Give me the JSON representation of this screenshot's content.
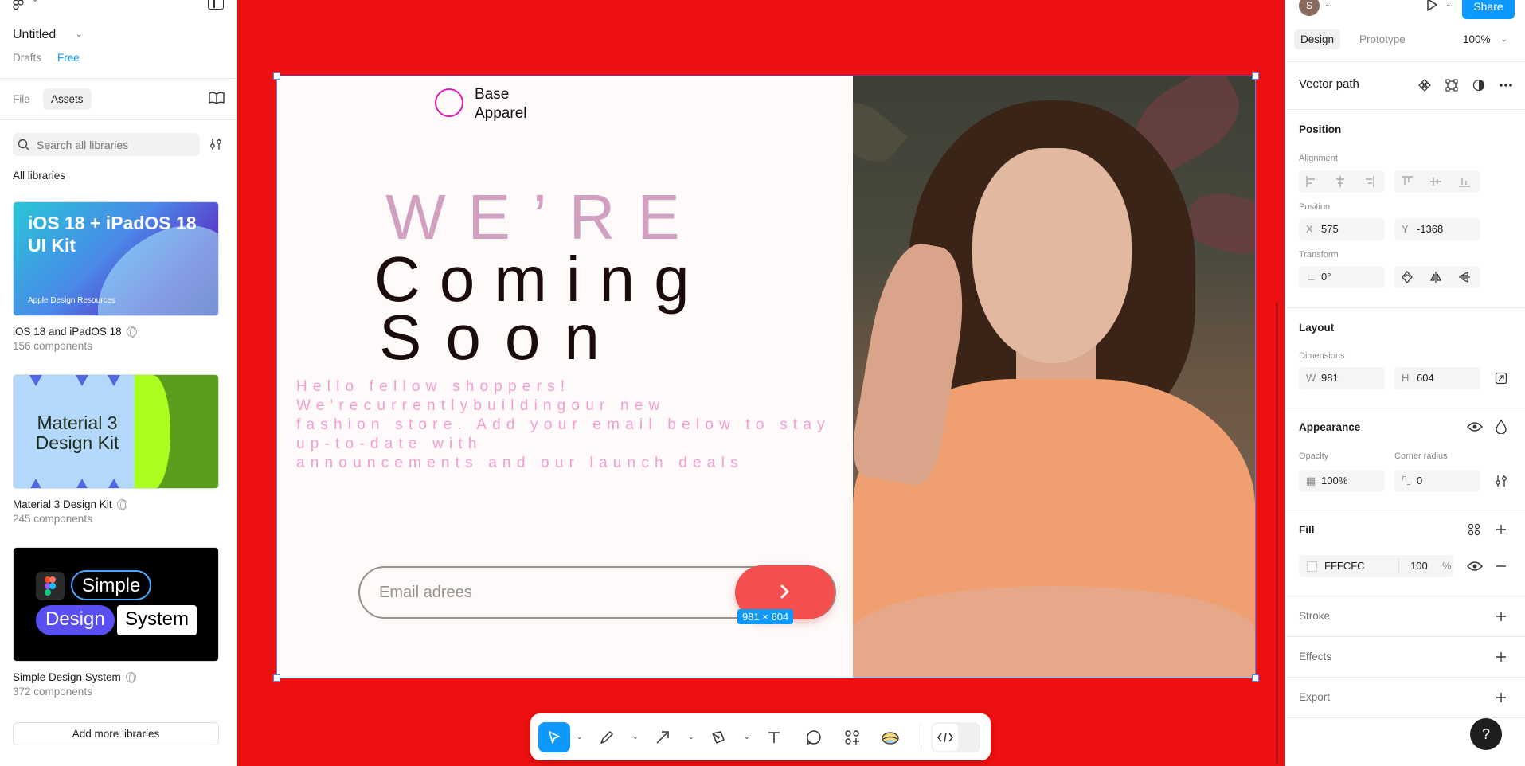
{
  "left_panel": {
    "file_title": "Untitled",
    "location": "Drafts",
    "plan": "Free",
    "tabs": {
      "file": "File",
      "assets": "Assets"
    },
    "search_placeholder": "Search all libraries",
    "section_title": "All libraries",
    "libraries": [
      {
        "name": "iOS 18 and iPadOS 18",
        "count": "156 components",
        "thumb_title": "iOS 18 + iPadOS 18 UI Kit",
        "thumb_caption": "Apple Design Resources"
      },
      {
        "name": "Material 3 Design Kit",
        "count": "245 components",
        "thumb_title": "Material 3 Design Kit"
      },
      {
        "name": "Simple Design System",
        "count": "372 components",
        "thumb_words": [
          "Simple",
          "Design",
          "System"
        ]
      }
    ],
    "add_button": "Add more libraries"
  },
  "canvas": {
    "background": "#ec1010",
    "frame_size": "981 × 604",
    "design": {
      "brand_line1": "Base",
      "brand_line2": "Apparel",
      "headline1": "WE’RE",
      "headline2": "Coming",
      "headline3": "Soon",
      "blurb_lines": [
        "Hello fellow shoppers!",
        "We'recurrentlybuildingour new",
        "fashion store. Add your email below to stay",
        "up-to-date with",
        "announcements and our launch deals"
      ],
      "email_placeholder": "Email adrees",
      "accent": "#f34f4f"
    }
  },
  "toolbar": {
    "tools": [
      "move-tool",
      "frame-tool",
      "shape-tool",
      "pen-tool",
      "text-tool",
      "comment-tool",
      "actions-tool",
      "ui3-tool",
      "dev-mode-toggle"
    ]
  },
  "right_panel": {
    "avatar_initial": "S",
    "share": "Share",
    "tabs": {
      "design": "Design",
      "prototype": "Prototype"
    },
    "zoom": "100%",
    "layer_name": "Vector path",
    "position": {
      "title": "Position",
      "alignment_label": "Alignment",
      "position_label": "Position",
      "x_prefix": "X",
      "x": "575",
      "y_prefix": "Y",
      "y": "-1368",
      "transform_label": "Transform",
      "rotation": "0°"
    },
    "layout": {
      "title": "Layout",
      "dimensions_label": "Dimensions",
      "w_prefix": "W",
      "w": "981",
      "h_prefix": "H",
      "h": "604"
    },
    "appearance": {
      "title": "Appearance",
      "opacity_label": "Opacity",
      "opacity": "100%",
      "radius_label": "Corner radius",
      "radius": "0"
    },
    "fill": {
      "title": "Fill",
      "hex": "FFFCFC",
      "opacity": "100",
      "unit": "%"
    },
    "stroke": "Stroke",
    "effects": "Effects",
    "export": "Export",
    "help": "?"
  }
}
